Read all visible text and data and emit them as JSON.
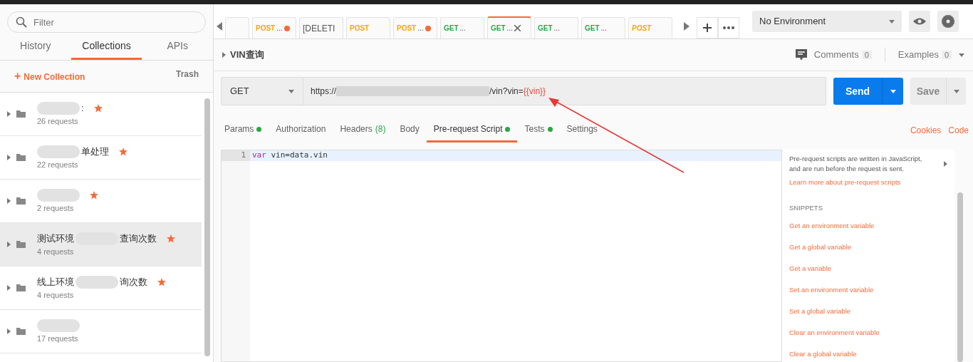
{
  "sidebar": {
    "filter": {
      "placeholder": "Filter"
    },
    "tabs": [
      {
        "label": "History",
        "selected": false
      },
      {
        "label": "Collections",
        "selected": true
      },
      {
        "label": "APIs",
        "selected": false
      }
    ],
    "new_collection": {
      "icon": "+",
      "label": "New Collection"
    },
    "trash": "Trash",
    "collections": [
      {
        "segments": [
          {
            "kind": "blur"
          },
          {
            "kind": "text",
            "text": ":"
          }
        ],
        "starred": true,
        "count": "26 requests",
        "selected": false
      },
      {
        "segments": [
          {
            "kind": "blur"
          },
          {
            "kind": "text",
            "text": "单处理"
          }
        ],
        "starred": true,
        "count": "22 requests",
        "selected": false
      },
      {
        "segments": [
          {
            "kind": "blur"
          }
        ],
        "starred": true,
        "count": "2 requests",
        "selected": false
      },
      {
        "segments": [
          {
            "kind": "text",
            "text": "测试环境"
          },
          {
            "kind": "blur"
          },
          {
            "kind": "text",
            "text": "查询次数"
          }
        ],
        "starred": true,
        "count": "4 requests",
        "selected": true
      },
      {
        "segments": [
          {
            "kind": "text",
            "text": "线上环境"
          },
          {
            "kind": "blur"
          },
          {
            "kind": "text",
            "text": "询次数"
          }
        ],
        "starred": true,
        "count": "4 requests",
        "selected": false
      },
      {
        "segments": [
          {
            "kind": "blur"
          }
        ],
        "starred": false,
        "count": "17 requests",
        "selected": false
      }
    ]
  },
  "request_tabs": [
    {
      "kind": "blank",
      "selected": false
    },
    {
      "kind": "method",
      "method": "POST",
      "label": "...",
      "unsaved": true,
      "preview": false,
      "selected": false
    },
    {
      "kind": "plain",
      "label": "[DELETI",
      "selected": false
    },
    {
      "kind": "method",
      "method": "POST",
      "unsaved": false,
      "preview": false,
      "selected": false
    },
    {
      "kind": "method",
      "method": "POST",
      "label": "...",
      "unsaved": true,
      "preview": false,
      "selected": false
    },
    {
      "kind": "method",
      "method": "GET",
      "label": "...",
      "unsaved": false,
      "preview": false,
      "selected": false
    },
    {
      "kind": "method",
      "method": "GET",
      "label": "...",
      "unsaved": false,
      "preview": false,
      "selected": true
    },
    {
      "kind": "method",
      "method": "GET",
      "label": "...",
      "unsaved": false,
      "preview": false,
      "selected": false
    },
    {
      "kind": "method",
      "method": "GET",
      "label": "...",
      "unsaved": false,
      "preview": false,
      "selected": false
    },
    {
      "kind": "method",
      "method": "POST",
      "unsaved": false,
      "preview": true,
      "selected": false
    }
  ],
  "environment": {
    "value": "No Environment"
  },
  "request": {
    "name": "VIN查询",
    "comments": {
      "label": "Comments",
      "count": "0"
    },
    "examples": {
      "label": "Examples",
      "count": "0"
    },
    "method": "GET",
    "url_prefix": "https://",
    "url_suffix": "/vin?vin=",
    "url_variable": "{{vin}}",
    "send": "Send",
    "save": "Save"
  },
  "sub_tabs": [
    {
      "label": "Params",
      "dot": true,
      "selected": false
    },
    {
      "label": "Authorization",
      "dot": false,
      "selected": false
    },
    {
      "label": "Headers",
      "count": "(8)",
      "dot": false,
      "selected": false
    },
    {
      "label": "Body",
      "dot": false,
      "selected": false
    },
    {
      "label": "Pre-request Script",
      "dot": true,
      "selected": true
    },
    {
      "label": "Tests",
      "dot": true,
      "selected": false
    },
    {
      "label": "Settings",
      "dot": false,
      "selected": false
    }
  ],
  "links": [
    "Cookies",
    "Code"
  ],
  "editor": {
    "lines": [
      {
        "number": "1",
        "keyword": "var",
        "code": " vin=data.vin"
      }
    ]
  },
  "help": {
    "text": "Pre-request scripts are written in JavaScript, and are run before the request is sent.",
    "link": "Learn more about pre-request scripts",
    "snippets_heading": "SNIPPETS",
    "snippets": [
      "Get an environment variable",
      "Get a global variable",
      "Get a variable",
      "Set an environment variable",
      "Set a global variable",
      "Clear an environment variable",
      "Clear a global variable"
    ]
  }
}
